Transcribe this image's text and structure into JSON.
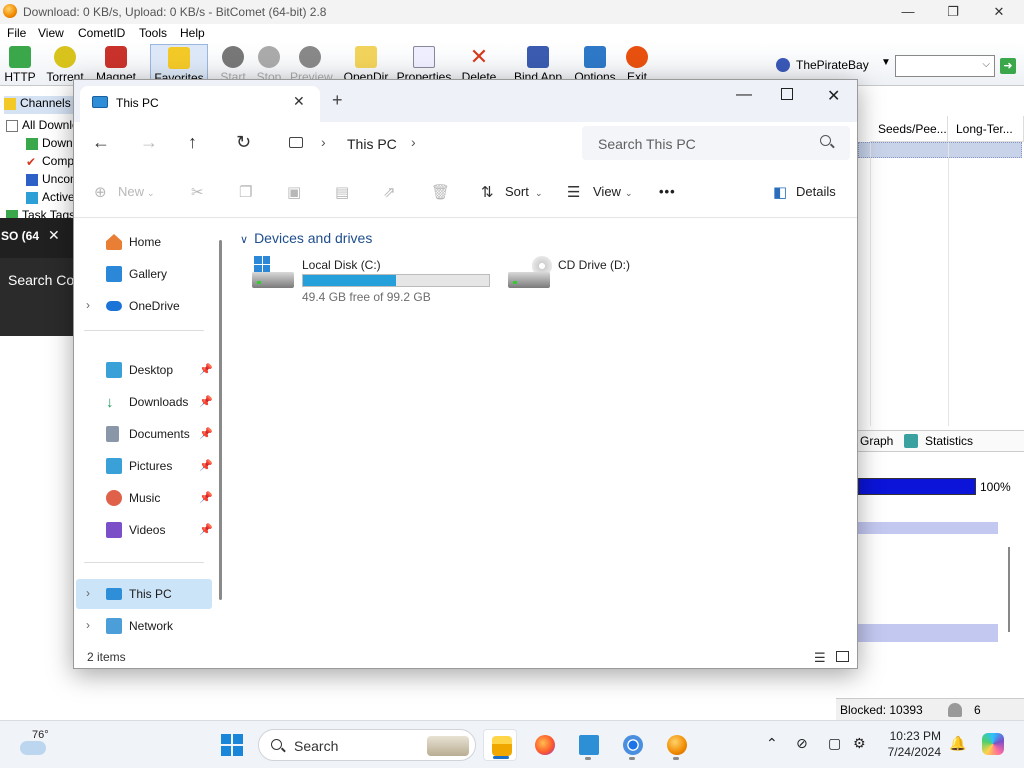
{
  "bitcomet": {
    "title": "Download: 0 KB/s, Upload: 0 KB/s - BitComet (64-bit) 2.8",
    "menu": [
      "File",
      "View",
      "CometID",
      "Tools",
      "Help"
    ],
    "toolbar": {
      "http": "HTTP",
      "torrent": "Torrent",
      "magnet": "Magnet",
      "favorites": "Favorites",
      "start": "Start",
      "stop": "Stop",
      "preview": "Preview",
      "opendir": "OpenDir",
      "properties": "Properties",
      "delete": "Delete",
      "bind_app": "Bind App",
      "options": "Options",
      "exit": "Exit"
    },
    "search_site": "ThePirateBay",
    "left_tree": {
      "channels": "Channels",
      "all_downloads": "All Downloads",
      "downloading": "Downloading",
      "completed": "Completed",
      "uncompleted": "Uncompleted",
      "active": "Active",
      "task_tags": "Task Tags"
    },
    "columns": {
      "seeds_peers": "Seeds/Pee...",
      "long_term": "Long-Ter..."
    },
    "tabs": {
      "graph": "Graph",
      "statistics": "Statistics"
    },
    "progress_label": "100%",
    "progress_value": 1.0,
    "status": {
      "blocked": "Blocked: 10393",
      "count": "6"
    }
  },
  "dark_window": {
    "tab_title": "SO (64",
    "search_text": "Search Co"
  },
  "explorer": {
    "tab_title": "This PC",
    "breadcrumb": "This PC",
    "search_placeholder": "Search This PC",
    "commands": {
      "new": "New",
      "sort": "Sort",
      "view": "View",
      "more": "•••",
      "details": "Details"
    },
    "sidebar": {
      "home": "Home",
      "gallery": "Gallery",
      "onedrive": "OneDrive",
      "desktop": "Desktop",
      "downloads": "Downloads",
      "documents": "Documents",
      "pictures": "Pictures",
      "music": "Music",
      "videos": "Videos",
      "this_pc": "This PC",
      "network": "Network"
    },
    "group_title": "Devices and drives",
    "drives": [
      {
        "name": "Local Disk (C:)",
        "free_text": "49.4 GB free of 99.2 GB",
        "used_fraction": 0.502
      },
      {
        "name": "CD Drive (D:)"
      }
    ],
    "status": "2 items"
  },
  "taskbar": {
    "temperature": "76°",
    "search_placeholder": "Search",
    "time": "10:23 PM",
    "date": "7/24/2024"
  }
}
